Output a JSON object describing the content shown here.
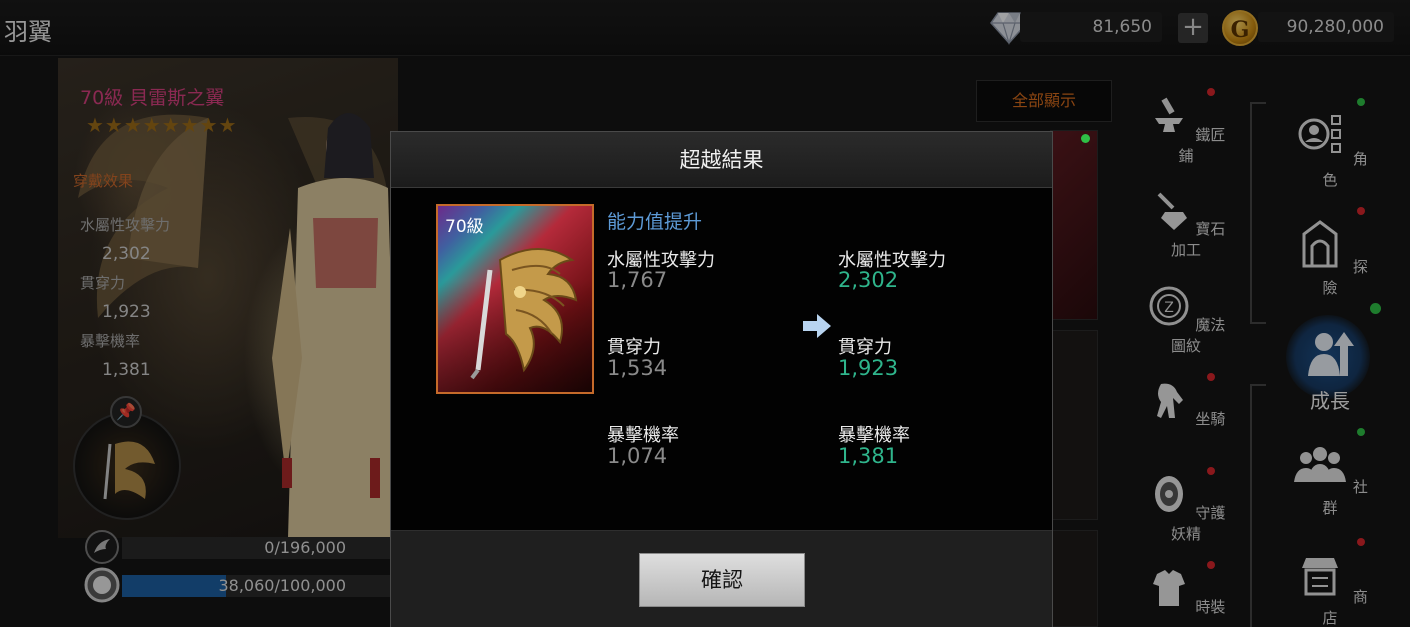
{
  "header": {
    "title": "羽翼",
    "diamond_amount": "81,650",
    "plus_label": "+",
    "gold_symbol": "G",
    "gold_amount": "90,280,000"
  },
  "character_panel": {
    "item_title": "70級 貝雷斯之翼",
    "stars": "★★★★★★★★",
    "star_count": 8,
    "wear_effect_label": "穿戴效果",
    "stats": [
      {
        "label": "水屬性攻擊力",
        "value": "2,302"
      },
      {
        "label": "貫穿力",
        "value": "1,923"
      },
      {
        "label": "暴擊機率",
        "value": "1,381"
      }
    ],
    "bar1_text": "0/196,000",
    "bar1_progress": 0,
    "bar2_text": "38,060/100,000",
    "bar2_progress": 0.3806
  },
  "show_all_label": "全部顯示",
  "side_menu": [
    {
      "label": "鐵匠鋪",
      "icon": "anvil-icon",
      "dot": "red"
    },
    {
      "label": "寶石加工",
      "icon": "gem-hammer-icon",
      "dot": "none"
    },
    {
      "label": "魔法圖紋",
      "icon": "magic-sigil-icon",
      "dot": "none"
    },
    {
      "label": "坐騎",
      "icon": "horse-icon",
      "dot": "red"
    },
    {
      "label": "守護妖精",
      "icon": "fairy-icon",
      "dot": "red"
    },
    {
      "label": "時裝",
      "icon": "armor-icon",
      "dot": "red"
    }
  ],
  "main_menu": [
    {
      "label": "角色",
      "icon": "character-icon",
      "dot": "green"
    },
    {
      "label": "探險",
      "icon": "adventure-icon",
      "dot": "red"
    },
    {
      "label": "成長",
      "icon": "growth-icon",
      "dot": "green"
    },
    {
      "label": "社群",
      "icon": "community-icon",
      "dot": "green"
    },
    {
      "label": "商店",
      "icon": "shop-icon",
      "dot": "red"
    }
  ],
  "modal": {
    "title": "超越結果",
    "item_level": "70級",
    "ability_title": "能力值提升",
    "rows": [
      {
        "label": "水屬性攻擊力",
        "old": "1,767",
        "new": "2,302"
      },
      {
        "label": "貫穿力",
        "old": "1,534",
        "new": "1,923"
      },
      {
        "label": "暴擊機率",
        "old": "1,074",
        "new": "1,381"
      }
    ],
    "confirm_label": "確認"
  },
  "colors": {
    "accent_new_value": "#2fb58c",
    "ability_title": "#5d9ad6",
    "item_title": "#d4407e",
    "notify_red": "#d4262b",
    "notify_green": "#2fbf46"
  }
}
